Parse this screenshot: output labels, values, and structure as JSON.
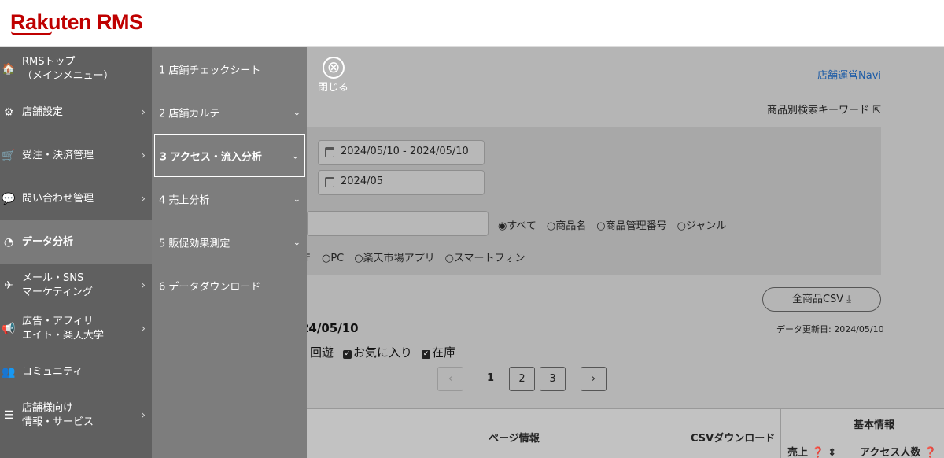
{
  "header": {
    "logo": "Rakuten RMS"
  },
  "menu_primary": [
    {
      "name": "home",
      "icon": "🏠",
      "label": "RMSトップ\n（メインメニュー）",
      "chevron": ""
    },
    {
      "name": "shop-settings",
      "icon": "⚙",
      "label": "店舗設定",
      "chevron": "›"
    },
    {
      "name": "orders",
      "icon": "🛒",
      "label": "受注・決済管理",
      "chevron": "›"
    },
    {
      "name": "inquiries",
      "icon": "💬",
      "label": "問い合わせ管理",
      "chevron": "›"
    },
    {
      "name": "data-analysis",
      "icon": "◔",
      "label": "データ分析",
      "chevron": ""
    },
    {
      "name": "mail-sns",
      "icon": "✈",
      "label": "メール・SNS\nマーケティング",
      "chevron": "›"
    },
    {
      "name": "ads",
      "icon": "📢",
      "label": "広告・アフィリ\nエイト・楽天大学",
      "chevron": "›"
    },
    {
      "name": "community",
      "icon": "👥",
      "label": "コミュニティ",
      "chevron": ""
    },
    {
      "name": "services",
      "icon": "☰",
      "label": "店舗様向け\n情報・サービス",
      "chevron": "›"
    }
  ],
  "menu_secondary": [
    {
      "name": "check-sheet",
      "label": "1 店舗チェックシート",
      "chevron": ""
    },
    {
      "name": "karte",
      "label": "2 店舗カルテ",
      "chevron": "⌄"
    },
    {
      "name": "access",
      "label": "3 アクセス・流入分析",
      "chevron": "⌄"
    },
    {
      "name": "sales",
      "label": "4 売上分析",
      "chevron": "⌄"
    },
    {
      "name": "promo",
      "label": "5 販促効果測定",
      "chevron": "⌄"
    },
    {
      "name": "download",
      "label": "6 データダウンロード",
      "chevron": ""
    }
  ],
  "content": {
    "close_icon": "⊗",
    "close_label": "閉じる",
    "navi_link": "店舗運営Navi",
    "keyword_link": "商品別検索キーワード ⇱",
    "date_range": "2024/05/10 - 2024/05/10",
    "month": "2024/05",
    "radio_type": "◉すべて　○商品名　○商品管理番号　○ジャンル",
    "radio_device": "〒　○PC　○楽天市場アプリ　○スマートフォン",
    "csv_button": "全商品CSV ⤓",
    "date_title": "24/05/10",
    "updated": "データ更新日: 2024/05/10",
    "check_revisit": "回遊",
    "check_fav": "お気に入り",
    "check_stock": "在庫",
    "check_mark": "✓",
    "pager_prev": "‹",
    "pager_current": "1",
    "pager_2": "2",
    "pager_3": "3",
    "pager_next": "›",
    "th_page": "ページ情報",
    "th_csv": "CSVダウンロード",
    "th_basic": "基本情報",
    "th_sales": "売上 ❓ ⇕",
    "th_access": "アクセス人数 ❓"
  }
}
